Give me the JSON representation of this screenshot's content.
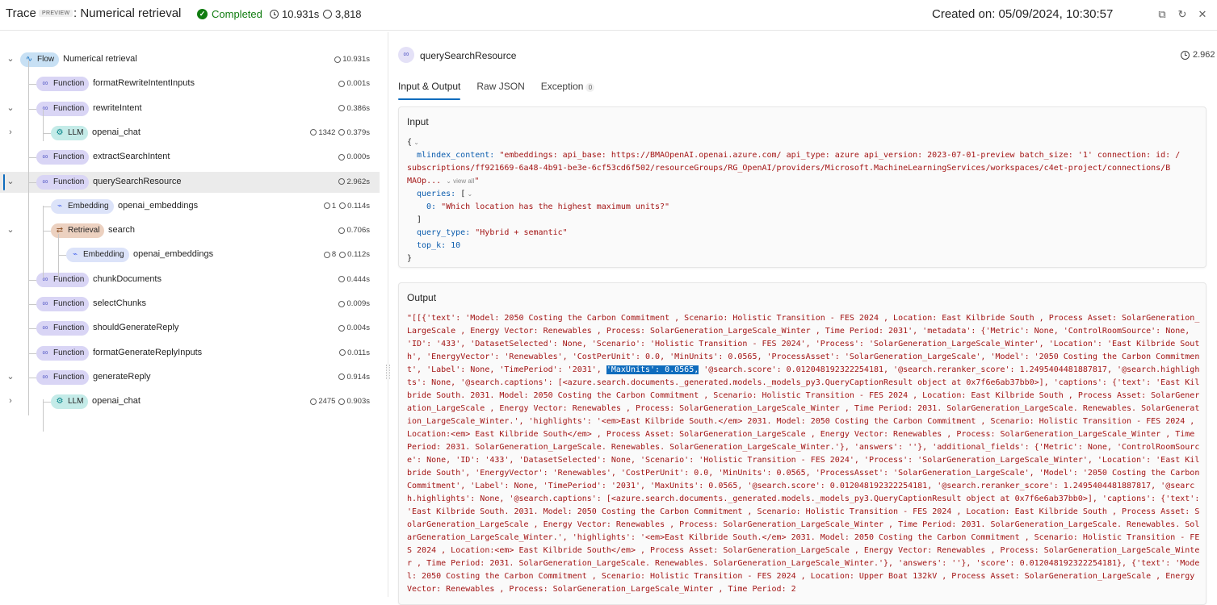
{
  "header": {
    "trace_label": "Trace",
    "preview_label": "PREVIEW",
    "flow_title": ": Numerical retrieval",
    "status": "Completed",
    "duration": "10.931s",
    "tokens": "3,818",
    "created_on": "Created on: 05/09/2024, 10:30:57",
    "icons": [
      "open-new-icon",
      "refresh-icon",
      "close-icon"
    ]
  },
  "tree": {
    "nodes": [
      {
        "kind": "Flow",
        "name": "Numerical retrieval",
        "tokens": "",
        "duration": "10.931s"
      },
      {
        "kind": "Function",
        "name": "formatRewriteIntentInputs",
        "tokens": "",
        "duration": "0.001s"
      },
      {
        "kind": "Function",
        "name": "rewriteIntent",
        "tokens": "",
        "duration": "0.386s"
      },
      {
        "kind": "LLM",
        "name": "openai_chat",
        "tokens": "1342",
        "duration": "0.379s"
      },
      {
        "kind": "Function",
        "name": "extractSearchIntent",
        "tokens": "",
        "duration": "0.000s"
      },
      {
        "kind": "Function",
        "name": "querySearchResource",
        "tokens": "",
        "duration": "2.962s"
      },
      {
        "kind": "Embedding",
        "name": "openai_embeddings",
        "tokens": "1",
        "duration": "0.114s"
      },
      {
        "kind": "Retrieval",
        "name": "search",
        "tokens": "",
        "duration": "0.706s"
      },
      {
        "kind": "Embedding",
        "name": "openai_embeddings",
        "tokens": "8",
        "duration": "0.112s"
      },
      {
        "kind": "Function",
        "name": "chunkDocuments",
        "tokens": "",
        "duration": "0.444s"
      },
      {
        "kind": "Function",
        "name": "selectChunks",
        "tokens": "",
        "duration": "0.009s"
      },
      {
        "kind": "Function",
        "name": "shouldGenerateReply",
        "tokens": "",
        "duration": "0.004s"
      },
      {
        "kind": "Function",
        "name": "formatGenerateReplyInputs",
        "tokens": "",
        "duration": "0.011s"
      },
      {
        "kind": "Function",
        "name": "generateReply",
        "tokens": "",
        "duration": "0.914s"
      },
      {
        "kind": "LLM",
        "name": "openai_chat",
        "tokens": "2475",
        "duration": "0.903s"
      }
    ]
  },
  "detail": {
    "title": "querySearchResource",
    "duration": "2.962",
    "tabs": [
      {
        "label": "Input & Output"
      },
      {
        "label": "Raw JSON"
      },
      {
        "label": "Exception",
        "count": "0"
      }
    ],
    "input": {
      "title": "Input",
      "open_brace": "{",
      "close_brace": "}",
      "mlindex_key": "mlindex_content:",
      "mlindex_value_l1": "\"embeddings: api_base: https://BMAOpenAI.openai.azure.com/ api_type: azure api_version: 2023-07-01-preview batch_size: '1' connection: id: /",
      "mlindex_value_l2": "subscriptions/ff921669-6a48-4b91-be3e-6cf53cd6f502/resourceGroups/RG_OpenAI/providers/Microsoft.MachineLearningServices/workspaces/c4et-project/connections/B",
      "mlindex_value_l3a": "MAOp...",
      "view_all": "view all",
      "mlindex_value_l3b": "\"",
      "queries_key": "queries:",
      "queries_open": "[",
      "query_index": "0:",
      "query_value": "\"Which location has the highest maximum units?\"",
      "queries_close": "]",
      "query_type_key": "query_type:",
      "query_type_value": "\"Hybrid + semantic\"",
      "top_k_key": "top_k:",
      "top_k_value": "10"
    },
    "output": {
      "title": "Output",
      "text_before": "\"[[{'text': 'Model: 2050 Costing the Carbon Commitment , Scenario: Holistic Transition - FES 2024 , Location: East Kilbride South , Process Asset: SolarGeneration_LargeScale , Energy Vector: Renewables , Process: SolarGeneration_LargeScale_Winter , Time Period: 2031', 'metadata': {'Metric': None, 'ControlRoomSource': None, 'ID': '433', 'DatasetSelected': None, 'Scenario': 'Holistic Transition - FES 2024', 'Process': 'SolarGeneration_LargeScale_Winter', 'Location': 'East Kilbride South', 'EnergyVector': 'Renewables', 'CostPerUnit': 0.0, 'MinUnits': 0.0565, 'ProcessAsset': 'SolarGeneration_LargeScale', 'Model': '2050 Costing the Carbon Commitment', 'Label': None, 'TimePeriod': '2031', ",
      "highlight": "'MaxUnits': 0.0565,",
      "text_after": " '@search.score': 0.012048192322254181, '@search.reranker_score': 1.2495404481887817, '@search.highlights': None, '@search.captions': [<azure.search.documents._generated.models._models_py3.QueryCaptionResult object at 0x7f6e6ab37bb0>], 'captions': {'text': 'East Kilbride South. 2031. Model: 2050 Costing the Carbon Commitment , Scenario: Holistic Transition - FES 2024 , Location: East Kilbride South , Process Asset: SolarGeneration_LargeScale , Energy Vector: Renewables , Process: SolarGeneration_LargeScale_Winter , Time Period: 2031. SolarGeneration_LargeScale. Renewables. SolarGeneration_LargeScale_Winter.', 'highlights': '<em>East Kilbride South.</em> 2031. Model: 2050 Costing the Carbon Commitment , Scenario: Holistic Transition - FES 2024 , Location:<em> East Kilbride South</em> , Process Asset: SolarGeneration_LargeScale , Energy Vector: Renewables , Process: SolarGeneration_LargeScale_Winter , Time Period: 2031. SolarGeneration_LargeScale. Renewables. SolarGeneration_LargeScale_Winter.'}, 'answers': ''}, 'additional_fields': {'Metric': None, 'ControlRoomSource': None, 'ID': '433', 'DatasetSelected': None, 'Scenario': 'Holistic Transition - FES 2024', 'Process': 'SolarGeneration_LargeScale_Winter', 'Location': 'East Kilbride South', 'EnergyVector': 'Renewables', 'CostPerUnit': 0.0, 'MinUnits': 0.0565, 'ProcessAsset': 'SolarGeneration_LargeScale', 'Model': '2050 Costing the Carbon Commitment', 'Label': None, 'TimePeriod': '2031', 'MaxUnits': 0.0565, '@search.score': 0.012048192322254181, '@search.reranker_score': 1.2495404481887817, '@search.highlights': None, '@search.captions': [<azure.search.documents._generated.models._models_py3.QueryCaptionResult object at 0x7f6e6ab37bb0>], 'captions': {'text': 'East Kilbride South. 2031. Model: 2050 Costing the Carbon Commitment , Scenario: Holistic Transition - FES 2024 , Location: East Kilbride South , Process Asset: SolarGeneration_LargeScale , Energy Vector: Renewables , Process: SolarGeneration_LargeScale_Winter , Time Period: 2031. SolarGeneration_LargeScale. Renewables. SolarGeneration_LargeScale_Winter.', 'highlights': '<em>East Kilbride South.</em> 2031. Model: 2050 Costing the Carbon Commitment , Scenario: Holistic Transition - FES 2024 , Location:<em> East Kilbride South</em> , Process Asset: SolarGeneration_LargeScale , Energy Vector: Renewables , Process: SolarGeneration_LargeScale_Winter , Time Period: 2031. SolarGeneration_LargeScale. Renewables. SolarGeneration_LargeScale_Winter.'}, 'answers': ''}, 'score': 0.012048192322254181}, {'text': 'Model: 2050 Costing the Carbon Commitment , Scenario: Holistic Transition - FES 2024 , Location: Upper Boat 132kV , Process Asset: SolarGeneration_LargeScale , Energy Vector: Renewables , Process: SolarGeneration_LargeScale_Winter , Time Period: 2"
    }
  }
}
